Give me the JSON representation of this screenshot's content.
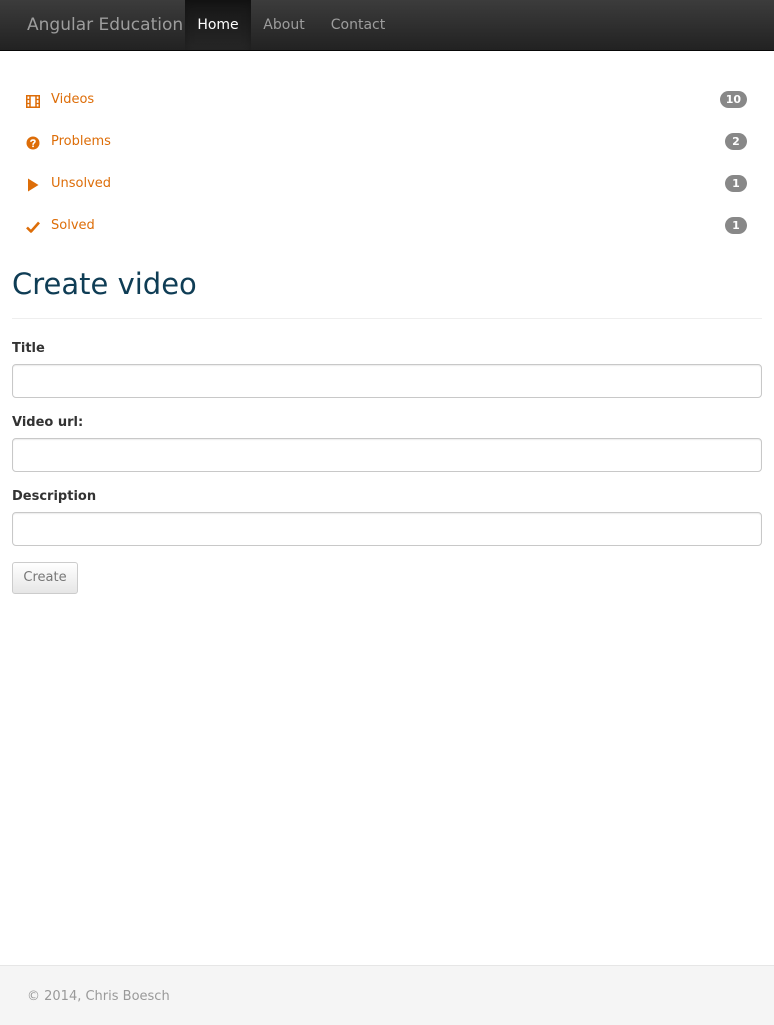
{
  "navbar": {
    "brand": "Angular Education",
    "items": [
      {
        "label": "Home",
        "active": true
      },
      {
        "label": "About",
        "active": false
      },
      {
        "label": "Contact",
        "active": false
      }
    ]
  },
  "sidebar": {
    "items": [
      {
        "label": "Videos",
        "icon": "film-icon",
        "count": "10"
      },
      {
        "label": "Problems",
        "icon": "question-circle-icon",
        "count": "2"
      },
      {
        "label": "Unsolved",
        "icon": "play-icon",
        "count": "1"
      },
      {
        "label": "Solved",
        "icon": "check-icon",
        "count": "1"
      }
    ],
    "accent_color": "#dd6d08"
  },
  "form": {
    "title": "Create video",
    "fields": [
      {
        "label": "Title",
        "value": "",
        "placeholder": ""
      },
      {
        "label": "Video url:",
        "value": "",
        "placeholder": ""
      },
      {
        "label": "Description",
        "value": "",
        "placeholder": ""
      }
    ],
    "submit_label": "Create"
  },
  "footer": {
    "text": "© 2014, Chris Boesch"
  }
}
